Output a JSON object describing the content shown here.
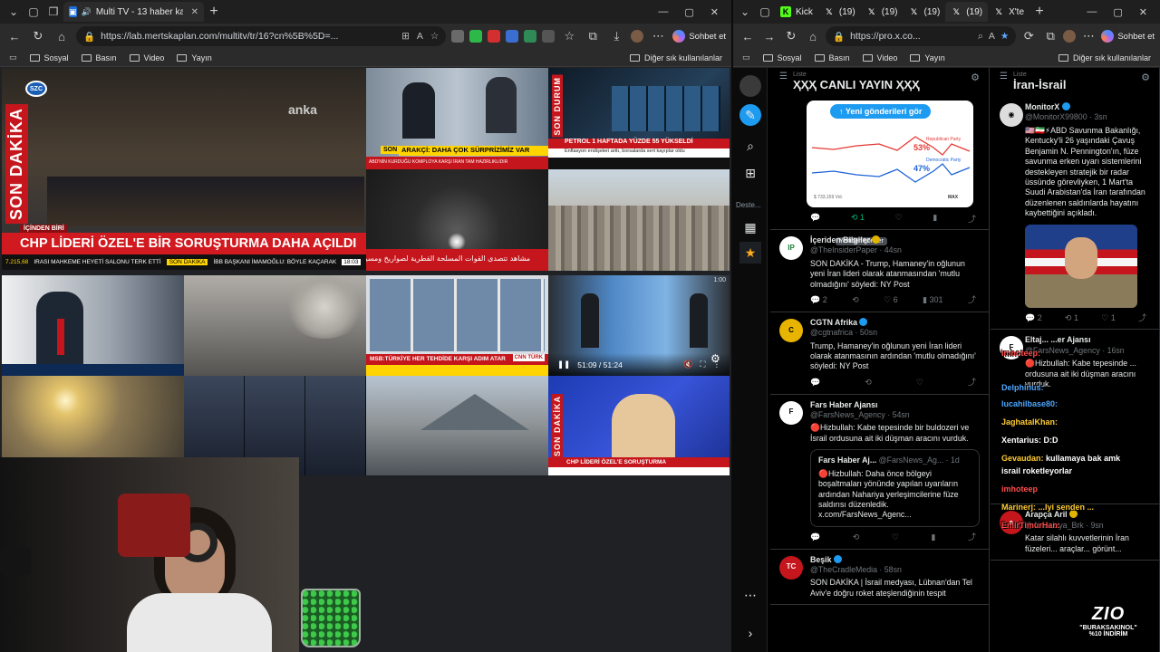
{
  "left_browser": {
    "tabs": [
      {
        "label": "Multi TV - 13 haber kanalını ...",
        "active": true
      }
    ],
    "url": "https://lab.mertskaplan.com/multitv/tr/16?cn%5B%5D=...",
    "chat_label": "Sohbet et",
    "bookmarks": [
      "Sosyal",
      "Basın",
      "Video",
      "Yayın"
    ],
    "bookmarks_right": "Diğer sık kullanılanlar"
  },
  "right_browser": {
    "tabs": [
      "Kick",
      "(19)",
      "(19)",
      "(19)",
      "(19)",
      "X'te"
    ],
    "url": "https://pro.x.co...",
    "chat_label": "Sohbet et",
    "bookmarks": [
      "Sosyal",
      "Basın",
      "Video",
      "Yayın"
    ],
    "bookmarks_right": "Diğer sık kullanılanlar"
  },
  "tv_grid": {
    "main_logo": "SZC",
    "main_vertical": "SON DAKİKA",
    "main_watermark": "anka",
    "main_kicker": "İÇİNDEN BİRİ",
    "main_headline": "CHP LİDERİ ÖZEL'E BİR SORUŞTURMA DAHA AÇILDI",
    "main_ticker_value": "7.215,68",
    "main_ticker": "IRASI MAHKEME HEYETİ SALONU TERK ETTİ",
    "main_ticker_tag": "SON DAKİKA",
    "main_ticker2": "İBB BAŞKANI İMAMOĞLU: BÖYLE KAÇARAK",
    "main_ticker_time": "18:03",
    "tile2_tag": "SON",
    "tile2_headline": "ARAKÇİ: DAHA ÇOK SÜRPRİZİMİZ VAR",
    "tile2_sub": "ABD'NİN KURDUĞU KOMPLOYA KARŞI İRAN TAM HAZIRLIKLIDIR",
    "tile3_vertical": "SON DURUM",
    "tile3_headline": "PETROL 1 HAFTADA YÜZDE 55 YÜKSELDİ",
    "tile3_sub": "Enflasyon endişeleri arttı, borsalarda sert kayıplar oldu",
    "tile6_arabic": "مشاهد تتصدى القوات المسلحة القطرية لصواريخ ومسيرات إيرانية",
    "tile9_headline": "MSB:TÜRKİYE HER TEHDİDE KARŞI ADIM ATAR",
    "tile9_logo": "CNN TÜRK",
    "video_time": "51:09 / 51:24",
    "tile10_time": "1:00",
    "tile13_vertical": "SON DAKİKA",
    "tile13_headline": "CHP LİDERİ ÖZEL'E SORUŞTURMA"
  },
  "tweetdeck": {
    "column1": {
      "sub": "Liste",
      "title": "ҲҲҲ CANLI YAYIN ҲҲҲ",
      "new_posts": "↑ Yeni gönderileri gör",
      "chart_republican": "53%",
      "chart_democratic": "47%",
      "chart_legend_r": "Republican Party",
      "chart_legend_d": "Democratic Party",
      "chart_volume": "$ 733,159 Vol.",
      "chart_max": "MAX",
      "tooltip": "Yeniden gönder",
      "tweets": [
        {
          "name": "İçeriden Bilgiler",
          "handle": "@TheInsiderPaper · 44sn",
          "text": "SON DAKİKA - Trump, Hamaney'in oğlunun yeni İran lideri olarak atanmasından 'mutlu olmadığını' söyledi: NY Post",
          "replies": "2",
          "likes": "6",
          "views": "301",
          "avatar": "IP"
        },
        {
          "name": "CGTN Afrika",
          "handle": "@cgtnafrica · 50sn",
          "text": "Trump, Hamaney'in oğlunun yeni İran lideri olarak atanmasının ardından 'mutlu olmadığını' söyledi: NY Post",
          "avatar": "C"
        },
        {
          "name": "Fars Haber Ajansı",
          "handle": "@FarsNews_Agency · 54sn",
          "text": "🔴Hizbullah: Kabe tepesinde bir buldozeri ve İsrail ordusuna ait iki düşman aracını vurduk.",
          "avatar": "F",
          "quote_name": "Fars Haber Aj...",
          "quote_handle": "@FarsNews_Ag... · 1d",
          "quote_text": "🔴Hizbullah: Daha önce bölgeyi boşaltmaları yönünde yapılan uyarıların ardından Nahariya yerleşimcilerine füze saldırısı düzenledik.",
          "quote_link": "x.com/FarsNews_Agenc..."
        },
        {
          "name": "Beşik",
          "handle": "@TheCradleMedia · 58sn",
          "text": "SON DAKİKA | İsrail medyası, Lübnan'dan Tel Aviv'e doğru roket ateşlendiğinin tespit",
          "avatar": "TC"
        }
      ]
    },
    "column2": {
      "sub": "Liste",
      "title": "İran-İsrail",
      "tweets": [
        {
          "name": "MonitorX",
          "handle": "@MonitorX99800 · 3sn",
          "text": "🇺🇸🇮🇷⚡ABD Savunma Bakanlığı, Kentucky'li 26 yaşındaki Çavuş Benjamin N. Pennington'ın, füze savunma erken uyarı sistemlerini destekleyen stratejik bir radar üssünde görevliyken, 1 Mart'ta Suudi Arabistan'da İran tarafından düzenlenen saldırılarda hayatını kaybettiğini açıkladı.",
          "replies": "2",
          "retweets": "1",
          "likes": "1"
        },
        {
          "name": "Eltaj... ...er Ajansı",
          "handle": "@FarsNews_Agency · 16sn",
          "text": "🔴Hizbullah: Kabe tepesinde ... ordusuna ait iki düşman aracını vurduk."
        },
        {
          "name": "Arapça Aril",
          "handle": "@AlArabiya_Brk · 9sn",
          "text": "Katar silahlı kuvvetlerinin İran füzeleri... araçlar... görünt..."
        }
      ]
    },
    "chat_overlay": [
      {
        "user": "imhoteep:",
        "color": "#ff4d4d"
      },
      {
        "user": "Delphinus:",
        "color": "#4da6ff"
      },
      {
        "user": "lucahilbase80:",
        "color": "#4da6ff"
      },
      {
        "user": "JaghatalKhan:",
        "color": "#ffcc33"
      },
      {
        "user": "Xentarius: D:D",
        "color": "#ffffff"
      },
      {
        "user": "Gevaudan:",
        "color": "#ffcc33",
        "text": "kullamaya bak amk"
      },
      {
        "user": "israil roketleyorlar",
        "color": "#ffffff"
      },
      {
        "user": "imhoteep",
        "color": "#ff4d4d"
      },
      {
        "user": "Marinerj: ...lyi senden ...",
        "color": "#ffcc33"
      },
      {
        "user": "EmirTimurHan:",
        "color": "#ff4d4d"
      }
    ]
  },
  "watermark": {
    "logo": "ZIO",
    "text": "\"BURAKSAKINOL\"",
    "sub": "%10 İNDİRİM"
  }
}
